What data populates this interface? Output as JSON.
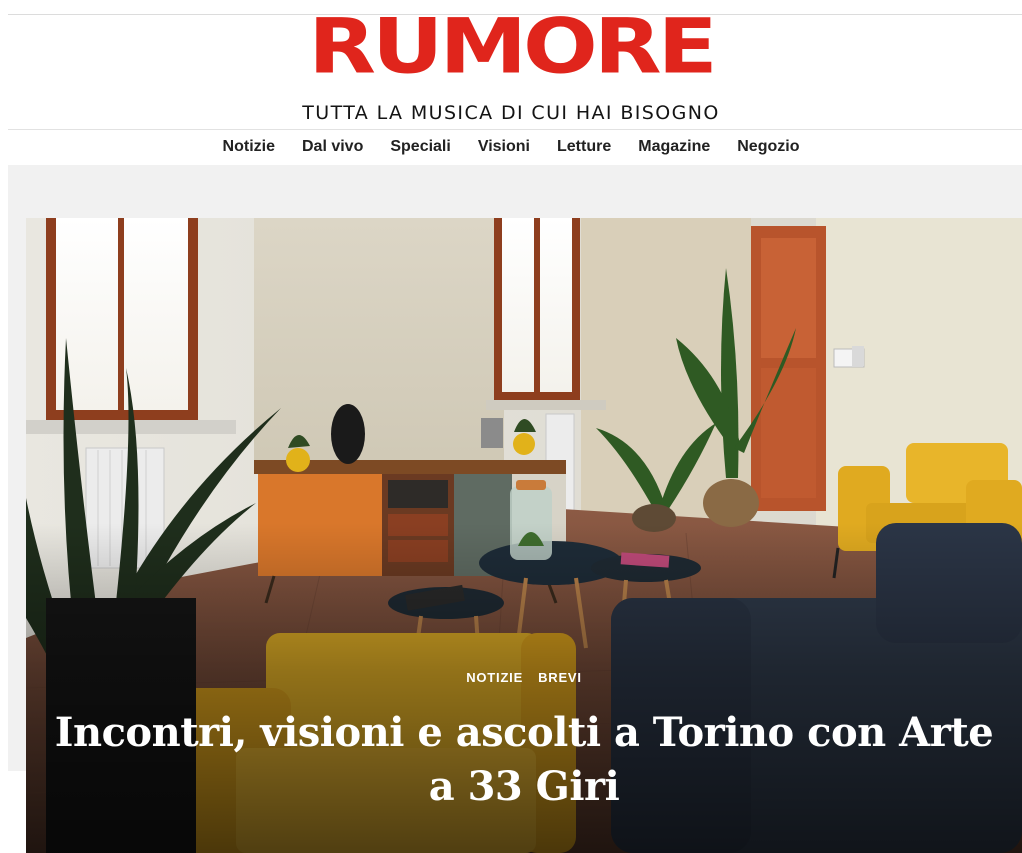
{
  "header": {
    "logo_text": "RUMORE",
    "tagline": "TUTTA LA MUSICA DI CUI HAI BISOGNO",
    "brand_color": "#e0251c"
  },
  "nav": {
    "items": [
      {
        "label": "Notizie"
      },
      {
        "label": "Dal vivo"
      },
      {
        "label": "Speciali"
      },
      {
        "label": "Visioni"
      },
      {
        "label": "Letture"
      },
      {
        "label": "Magazine"
      },
      {
        "label": "Negozio"
      }
    ]
  },
  "hero": {
    "categories": [
      {
        "label": "NOTIZIE"
      },
      {
        "label": "BREVI"
      }
    ],
    "title": "Incontri, visioni e ascolti a Torino con Arte a 33 Giri"
  }
}
